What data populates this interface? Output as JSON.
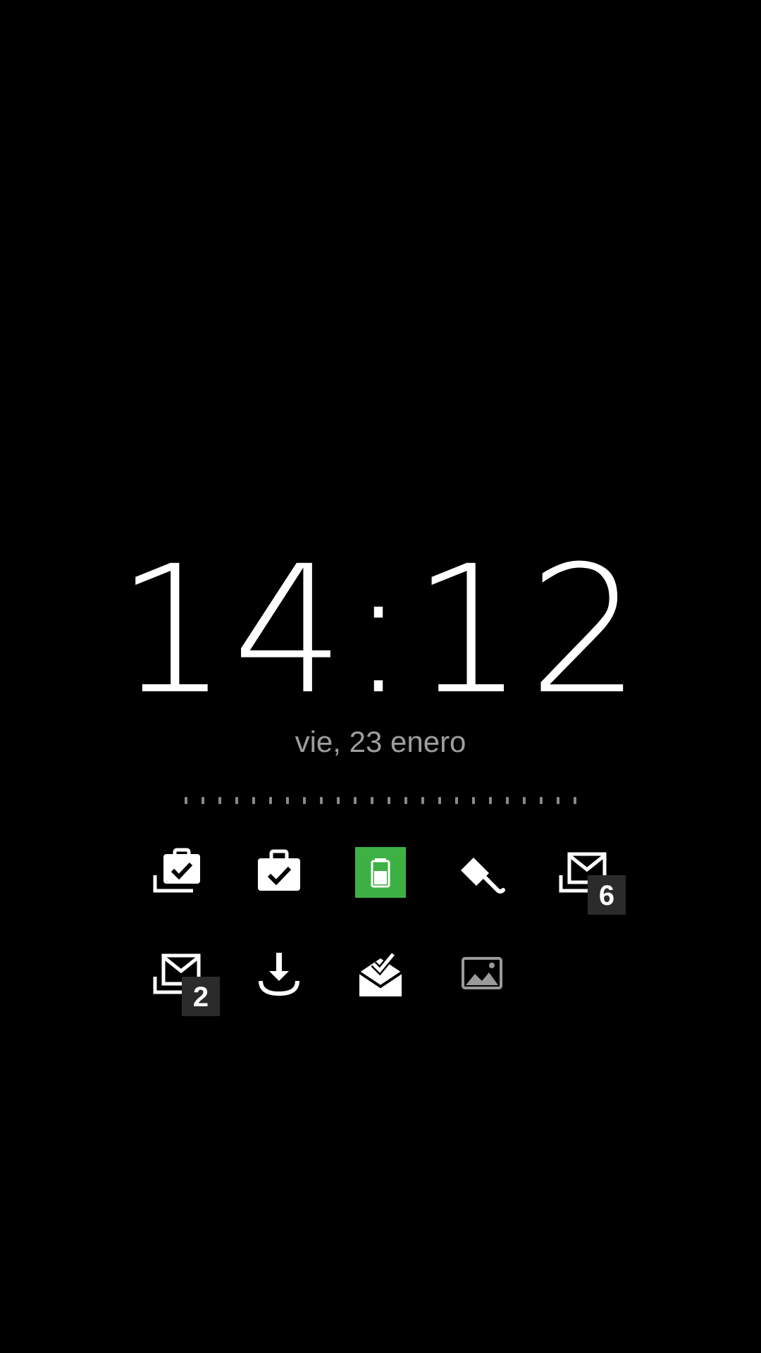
{
  "lockscreen": {
    "time": "14:12",
    "date": "vie, 23 enero"
  },
  "pager": {
    "dot_count": 24
  },
  "notifications": [
    {
      "icon": "stacked-clipboard-check-icon"
    },
    {
      "icon": "briefcase-check-icon"
    },
    {
      "icon": "battery-icon",
      "color": "#3db143"
    },
    {
      "icon": "paint-brush-icon"
    },
    {
      "icon": "stacked-gmail-icon",
      "badge": "6"
    },
    {
      "icon": "stacked-gmail-icon",
      "badge": "2"
    },
    {
      "icon": "download-icon"
    },
    {
      "icon": "mail-read-check-icon"
    },
    {
      "icon": "image-icon"
    }
  ],
  "colors": {
    "background": "#000000",
    "clock": "#ffffff",
    "date": "#9e9e9e",
    "pager_dot": "#8a8a8a",
    "battery_green": "#3db143",
    "badge_bg": "#2b2b2b"
  }
}
